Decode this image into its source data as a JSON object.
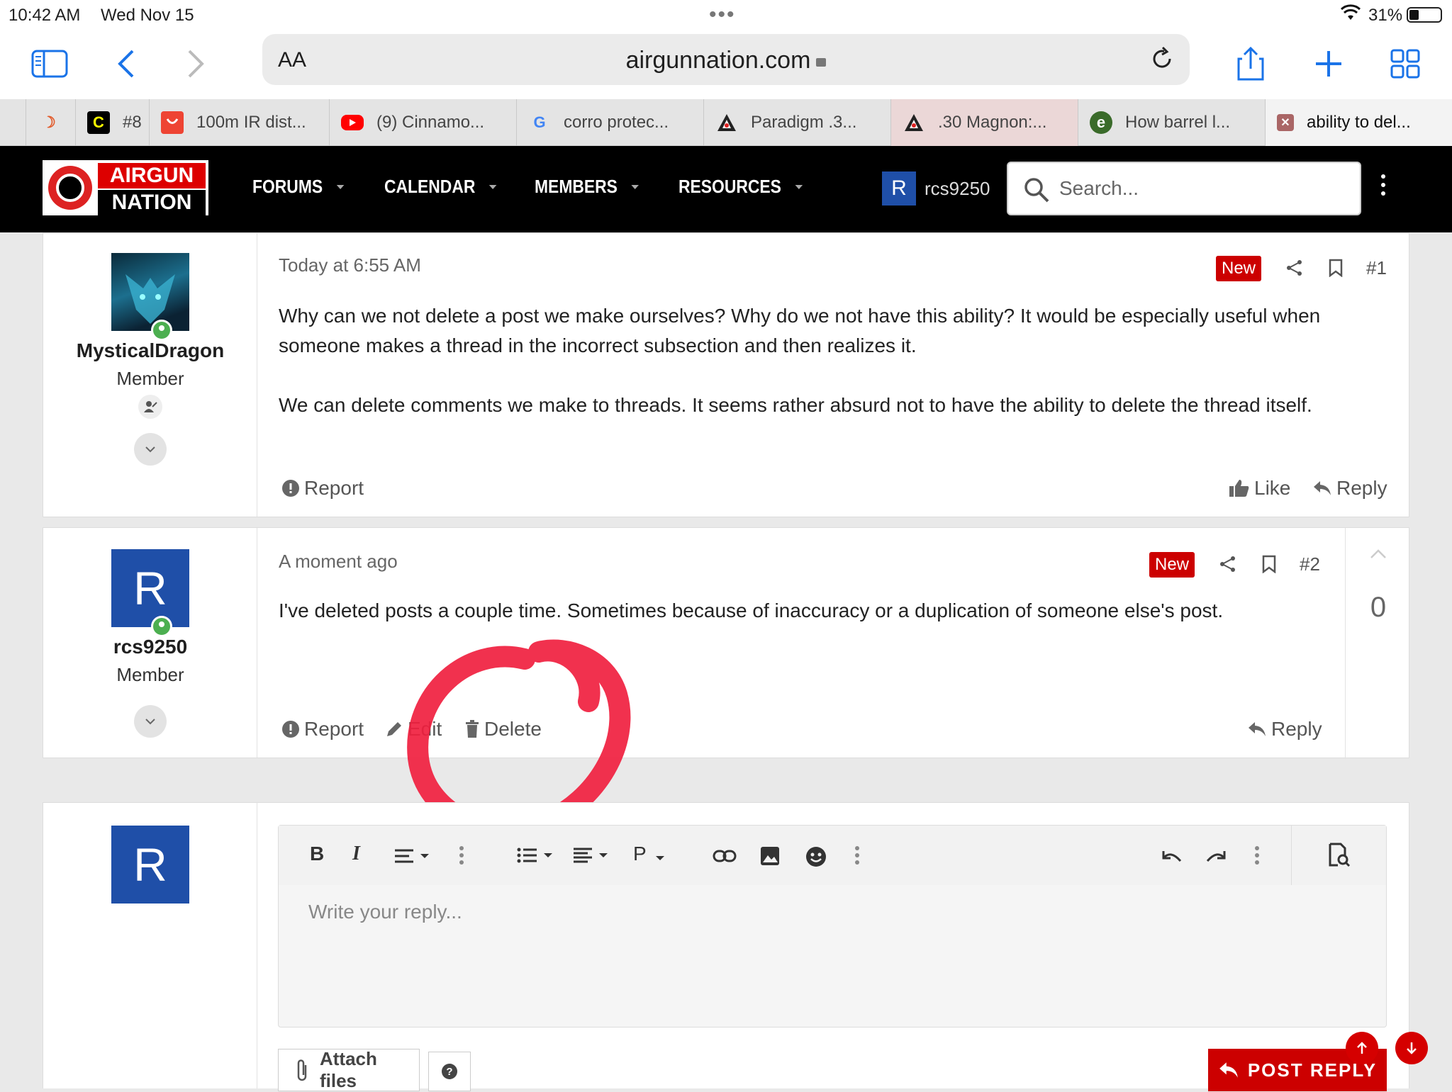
{
  "status_bar": {
    "time": "10:42 AM",
    "date": "Wed Nov 15",
    "battery": "31%",
    "battery_level": 0.31
  },
  "browser": {
    "aa_label": "AA",
    "url": "airgunnation.com",
    "tabs": [
      {
        "label": "",
        "icon": "moon-icon"
      },
      {
        "label": "#8",
        "icon": "c-icon"
      },
      {
        "label": "100m IR dist...",
        "icon": "aliexpress-icon"
      },
      {
        "label": "(9) Cinnamo...",
        "icon": "youtube-icon"
      },
      {
        "label": "corro protec...",
        "icon": "google-icon"
      },
      {
        "label": "Paradigm .3...",
        "icon": "paradigm-icon"
      },
      {
        "label": ".30 Magnon:...",
        "icon": "paradigm-icon"
      },
      {
        "label": "How barrel l...",
        "icon": "site-icon"
      },
      {
        "label": "ability to del...",
        "icon": "close-icon"
      }
    ]
  },
  "site": {
    "logo_line1": "AIRGUN",
    "logo_line2": "NATION",
    "nav": [
      "FORUMS",
      "CALENDAR",
      "MEMBERS",
      "RESOURCES"
    ],
    "user_initial": "R",
    "username": "rcs9250",
    "search_placeholder": "Search..."
  },
  "posts": [
    {
      "author": "MysticalDragon",
      "role": "Member",
      "time": "Today at 6:55 AM",
      "badge": "New",
      "number": "#1",
      "paragraphs": [
        "Why can we not delete a post we make ourselves? Why do we not have this ability? It would be especially useful when someone makes a thread in the incorrect subsection and then realizes it.",
        "We can delete comments we make to threads. It seems rather absurd not to have the ability to delete the thread itself."
      ],
      "actions": {
        "report": "Report",
        "like": "Like",
        "reply": "Reply"
      }
    },
    {
      "author": "rcs9250",
      "avatar_initial": "R",
      "role": "Member",
      "time": "A moment ago",
      "badge": "New",
      "number": "#2",
      "body": "I've deleted posts a couple time. Sometimes because of inaccuracy or a duplication of someone else's post.",
      "votes": "0",
      "actions": {
        "report": "Report",
        "edit": "Edit",
        "delete": "Delete",
        "reply": "Reply"
      }
    }
  ],
  "reply_box": {
    "avatar_initial": "R",
    "placeholder": "Write your reply...",
    "toolbar": {
      "bold": "B",
      "italic": "I",
      "paragraph": "P"
    },
    "attach_label": "Attach files",
    "post_label": "POST REPLY"
  },
  "colors": {
    "brand_red": "#cc0000",
    "header_bg": "#000000",
    "avatar_blue": "#1f4fa8",
    "annotation": "#f0203f"
  }
}
